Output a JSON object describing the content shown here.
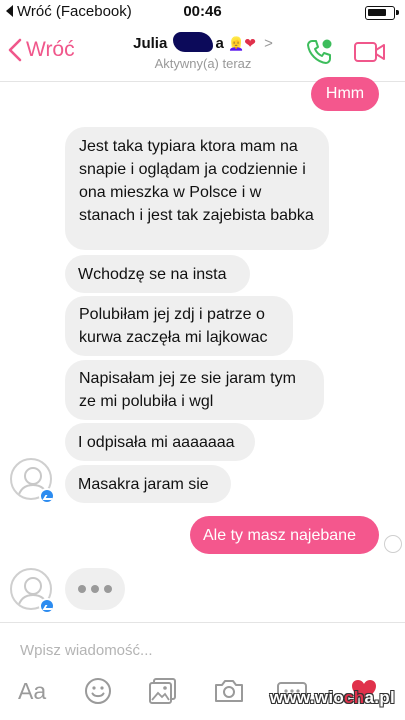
{
  "status_bar": {
    "back_label": "Wróć (Facebook)",
    "time": "00:46"
  },
  "header": {
    "back_label": "Wróć",
    "contact_first": "Julia",
    "contact_last_partial": "a",
    "emoji": "👱‍♀️",
    "heart": "❤",
    "chevron": ">",
    "status": "Aktywny(a) teraz"
  },
  "messages": [
    {
      "from": "me",
      "text": "Hmm"
    },
    {
      "from": "them",
      "text": "Jest taka typiara ktora mam na snapie i oglądam ja codziennie i ona mieszka w Polsce i w stanach i jest tak zajebista babka"
    },
    {
      "from": "them",
      "text": "Wchodzę se na insta"
    },
    {
      "from": "them",
      "text": "Polubiłam jej zdj i patrze o kurwa zaczęła mi lajkowac"
    },
    {
      "from": "them",
      "text": "Napisałam jej ze sie jaram tym ze mi polubiła i wgl"
    },
    {
      "from": "them",
      "text": "I odpisała mi aaaaaaa"
    },
    {
      "from": "them",
      "text": "Masakra jaram sie"
    },
    {
      "from": "me",
      "text": "Ale ty masz najebane"
    }
  ],
  "composer": {
    "placeholder": "Wpisz wiadomość...",
    "aa_label": "Aa"
  },
  "watermark": {
    "prefix": "www.wio",
    "highlight": "ch",
    "suffix": "a.pl"
  },
  "colors": {
    "accent": "#f0578b",
    "outgoing_bubble": "#f4578d",
    "incoming_bubble": "#efefef",
    "call_icon": "#3dbd5c",
    "messenger_badge": "#2d8cf0"
  }
}
